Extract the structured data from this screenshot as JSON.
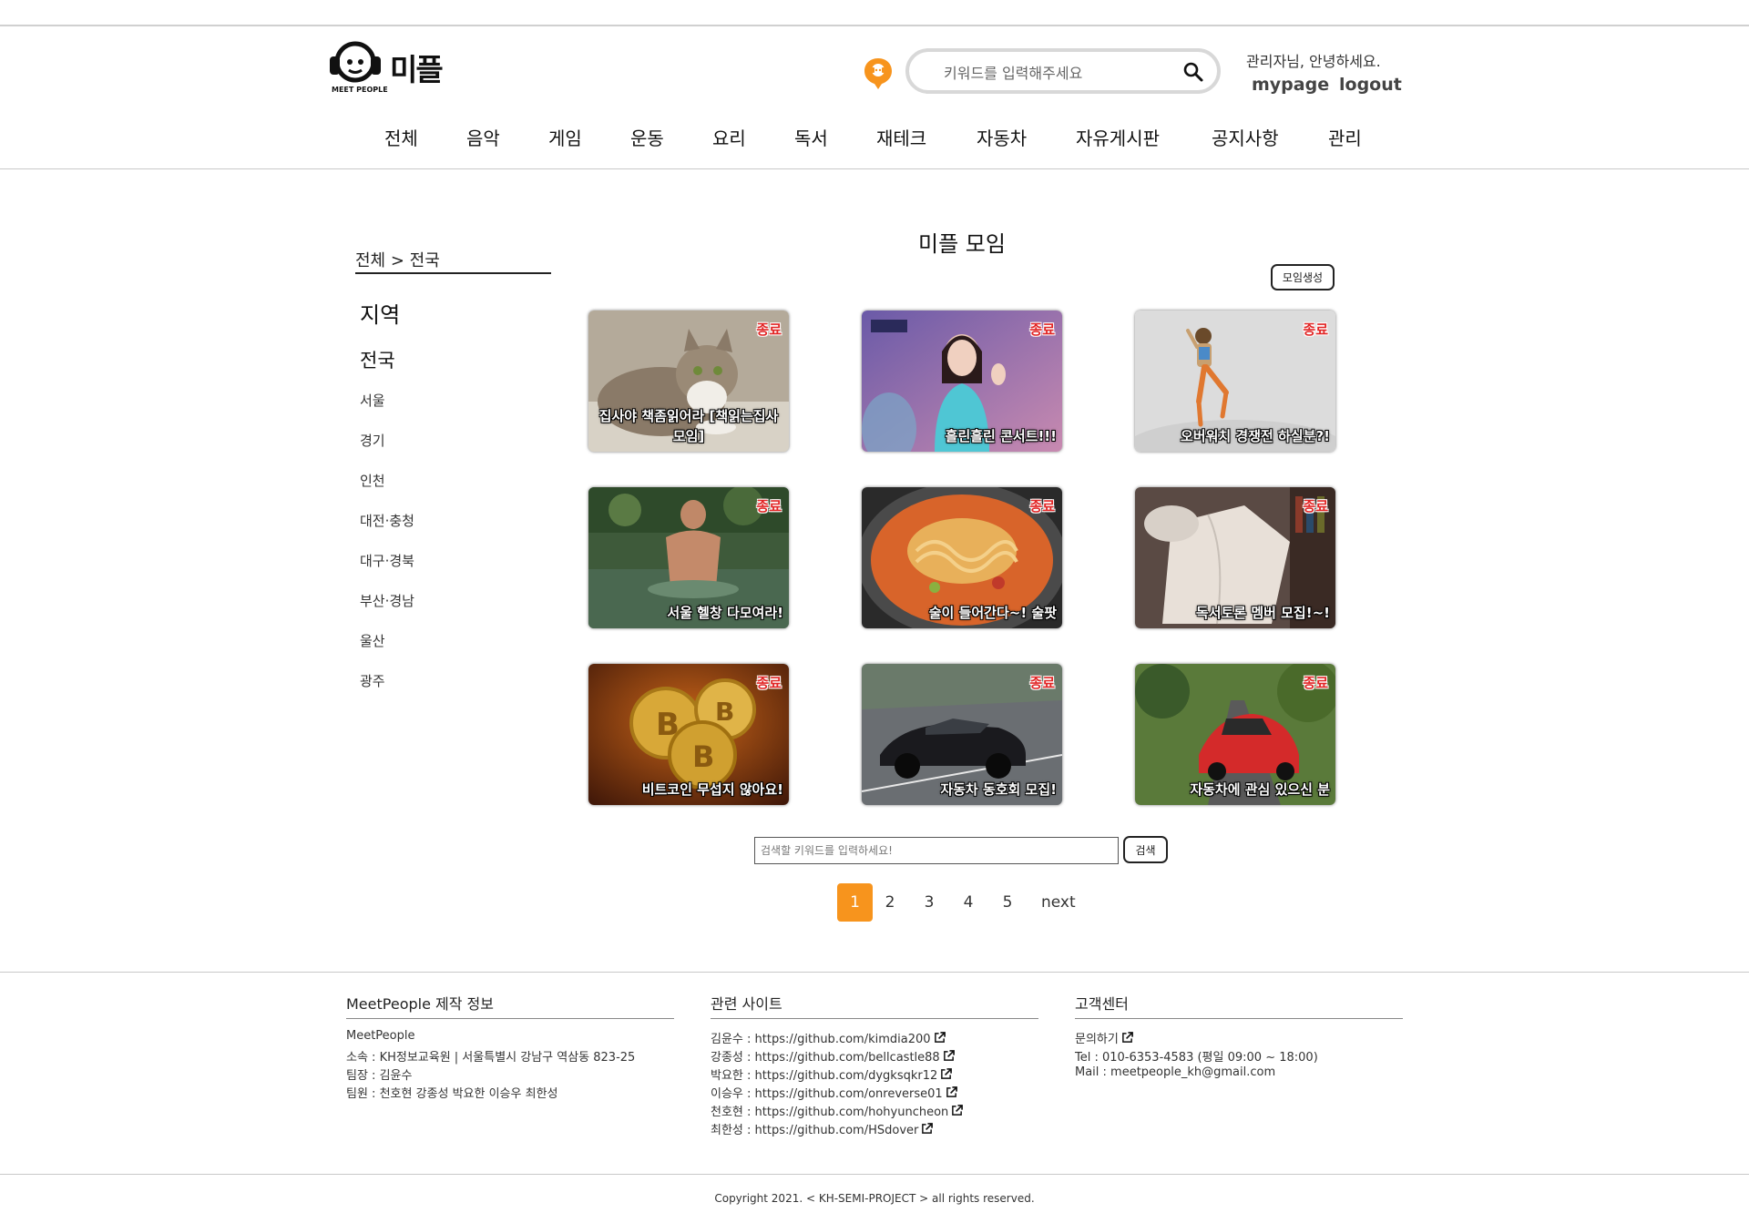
{
  "header": {
    "logo_text": "미플",
    "logo_sub": "MEET PEOPLE",
    "search_placeholder": "키워드를 입력해주세요",
    "greeting": "관리자님, 안녕하세요.",
    "mypage_label": "mypage",
    "logout_label": "logout"
  },
  "nav": [
    "전체",
    "음악",
    "게임",
    "운동",
    "요리",
    "독서",
    "재테크",
    "자동차",
    "자유게시판",
    "공지사항",
    "관리"
  ],
  "sidebar": {
    "breadcrumb": "전체 > 전국",
    "title": "지역",
    "current": "전국",
    "items": [
      "서울",
      "경기",
      "인천",
      "대전·충청",
      "대구·경북",
      "부산·경남",
      "울산",
      "광주"
    ]
  },
  "main": {
    "title": "미플 모임",
    "create_label": "모임생성"
  },
  "cards": [
    {
      "status": "종료",
      "title": "집사야 책좀읽어라 [책읽는집사모임]",
      "image": "cat"
    },
    {
      "status": "종료",
      "title": "흘린흘린 콘서트!!!",
      "image": "concert"
    },
    {
      "status": "종료",
      "title": "오버워치 경쟁전 하실분?!",
      "image": "game-hero"
    },
    {
      "status": "종료",
      "title": "서울 헬창 다모여라!",
      "image": "river-man"
    },
    {
      "status": "종료",
      "title": "술이 들어간다~! 술팟",
      "image": "ramen"
    },
    {
      "status": "종료",
      "title": "독서토론 멤버 모집!~!",
      "image": "book"
    },
    {
      "status": "종료",
      "title": "비트코인 무섭지 않아요!",
      "image": "bitcoin"
    },
    {
      "status": "종료",
      "title": "자동차 동호회 모집!",
      "image": "black-car"
    },
    {
      "status": "종료",
      "title": "자동차에 관심 있으신 분",
      "image": "red-car"
    }
  ],
  "bottom_search": {
    "placeholder": "검색할 키워드를 입력하세요!",
    "button_label": "검색"
  },
  "pagination": {
    "pages": [
      "1",
      "2",
      "3",
      "4",
      "5"
    ],
    "active": "1",
    "next_label": "next"
  },
  "footer": {
    "col1": {
      "title": "MeetPeople 제작 정보",
      "lines": [
        "MeetPeople",
        "소속 : KH정보교육원 | 서울특별시 강남구 역삼동 823-25",
        "팀장 : 김윤수",
        "팀원 : 천호현 강종성 박요한 이승우 최한성"
      ]
    },
    "col2": {
      "title": "관련 사이트",
      "lines": [
        "김윤수 : https://github.com/kimdia200",
        "강종성 : https://github.com/bellcastle88",
        "박요한 : https://github.com/dygksqkr12",
        "이승우 : https://github.com/onreverse01",
        "천호현 : https://github.com/hohyuncheon",
        "최한성 : https://github.com/HSdover"
      ]
    },
    "col3": {
      "title": "고객센터",
      "lines": [
        "문의하기",
        "Tel : 010-6353-4583 (평일 09:00 ~ 18:00)",
        "Mail : meetpeople_kh@gmail.com"
      ]
    },
    "copyright": "Copyright 2021. < KH-SEMI-PROJECT > all rights reserved."
  },
  "colors": {
    "accent": "#f7941d",
    "status": "#e12525"
  }
}
